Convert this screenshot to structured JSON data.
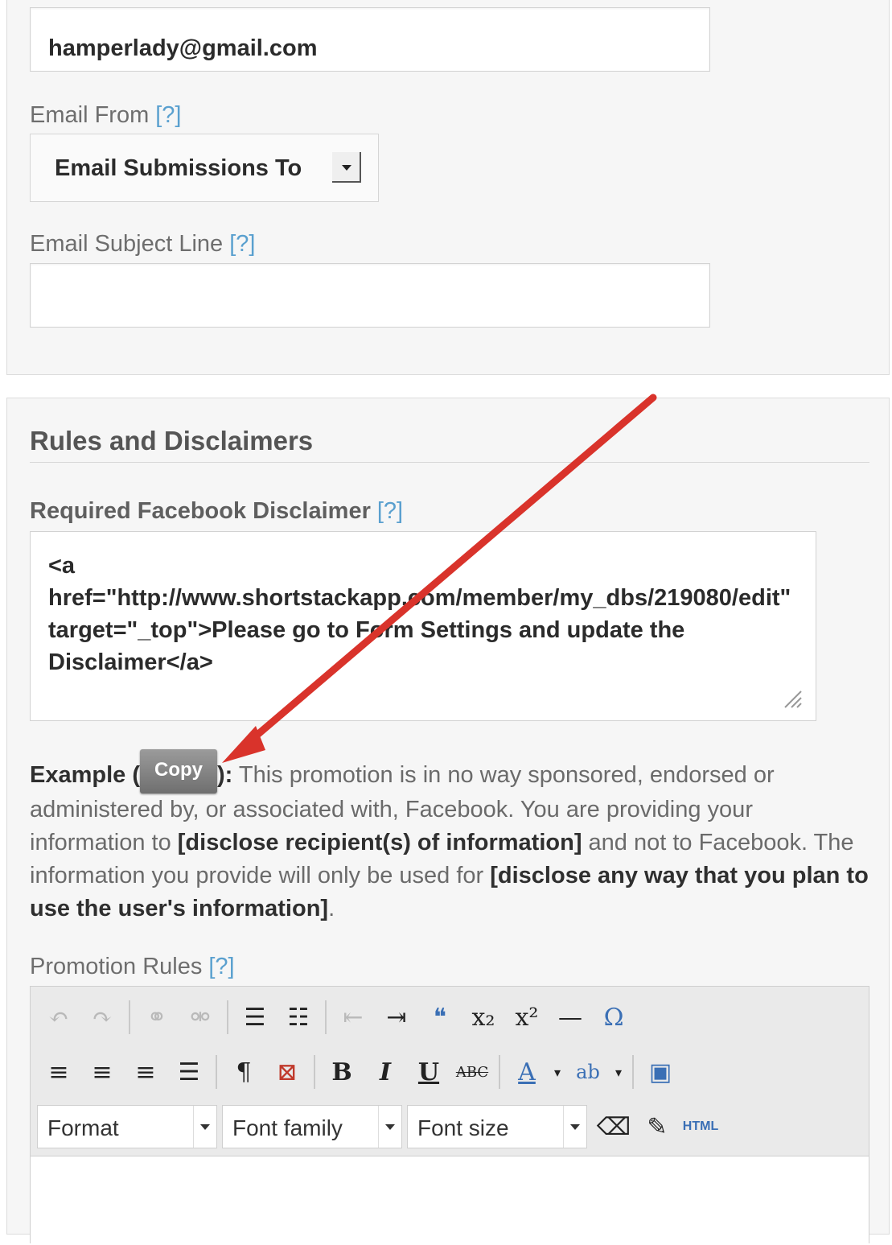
{
  "email_to": {
    "value": "hamperlady@gmail.com"
  },
  "email_from": {
    "label": "Email From",
    "help": "[?]",
    "selected": "Email Submissions To"
  },
  "email_subject": {
    "label": "Email Subject Line",
    "help": "[?]",
    "value": ""
  },
  "rules_section": {
    "title": "Rules and Disclaimers",
    "disclaimer_label": "Required Facebook Disclaimer",
    "disclaimer_help": "[?]",
    "disclaimer_value": "<a href=\"http://www.shortstackapp.com/member/my_dbs/219080/edit\" target=\"_top\">Please go to Form Settings and update the Disclaimer</a>",
    "example": {
      "lead": "Example (",
      "copy_label": "Copy",
      "close": "):",
      "t1": " This promotion is in no way sponsored, endorsed or administered by, or associated with, Facebook. You are providing your information to ",
      "b1": "[disclose recipient(s) of information]",
      "t2": " and not to Facebook. The information you provide will only be used for ",
      "b2": "[disclose any way that you plan to use the user's information]",
      "t3": "."
    },
    "promotion_rules_label": "Promotion Rules",
    "promotion_rules_help": "[?]"
  },
  "editor": {
    "format_label": "Format",
    "font_family_label": "Font family",
    "font_size_label": "Font size",
    "html_label": "HTML"
  },
  "colors": {
    "arrow": "#d9332b",
    "help_link": "#5aa0cf"
  }
}
